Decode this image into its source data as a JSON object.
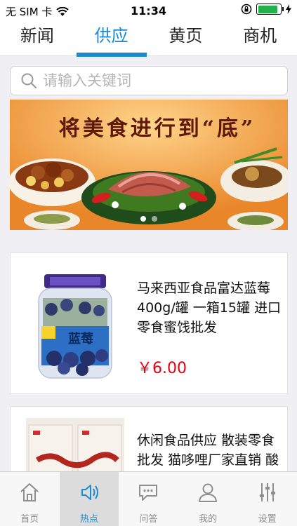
{
  "status_bar": {
    "carrier": "无 SIM 卡",
    "time": "11:34",
    "battery_level": 0.9,
    "icons": [
      "wifi-icon",
      "rotation-lock-icon",
      "battery-icon",
      "charging-icon"
    ]
  },
  "top_tabs": [
    {
      "label": "新闻",
      "active": false
    },
    {
      "label": "供应",
      "active": true
    },
    {
      "label": "黄页",
      "active": false
    },
    {
      "label": "商机",
      "active": false
    }
  ],
  "search": {
    "placeholder": "请输入关键词",
    "icon": "search-icon"
  },
  "banner": {
    "slogan": "将美食进行到“底”",
    "slide_count": 2,
    "active_slide": 1
  },
  "products": [
    {
      "title": "马来西亚食品富达蓝莓400g/罐 一箱15罐 进口零食蜜饯批发",
      "price": "￥6.00",
      "jar_text": "蓝莓"
    },
    {
      "title": "休闲食品供应 散装零食批发 猫哆哩厂家直销 酸",
      "price": ""
    }
  ],
  "bottom_nav": [
    {
      "label": "首页",
      "icon": "home-icon",
      "active": false
    },
    {
      "label": "热点",
      "icon": "speaker-icon",
      "active": true
    },
    {
      "label": "问答",
      "icon": "chat-icon",
      "active": false
    },
    {
      "label": "我的",
      "icon": "user-icon",
      "active": false
    },
    {
      "label": "设置",
      "icon": "sliders-icon",
      "active": false
    }
  ],
  "colors": {
    "accent": "#1a8ad6",
    "price": "#e60012",
    "battery": "#21b14b"
  }
}
